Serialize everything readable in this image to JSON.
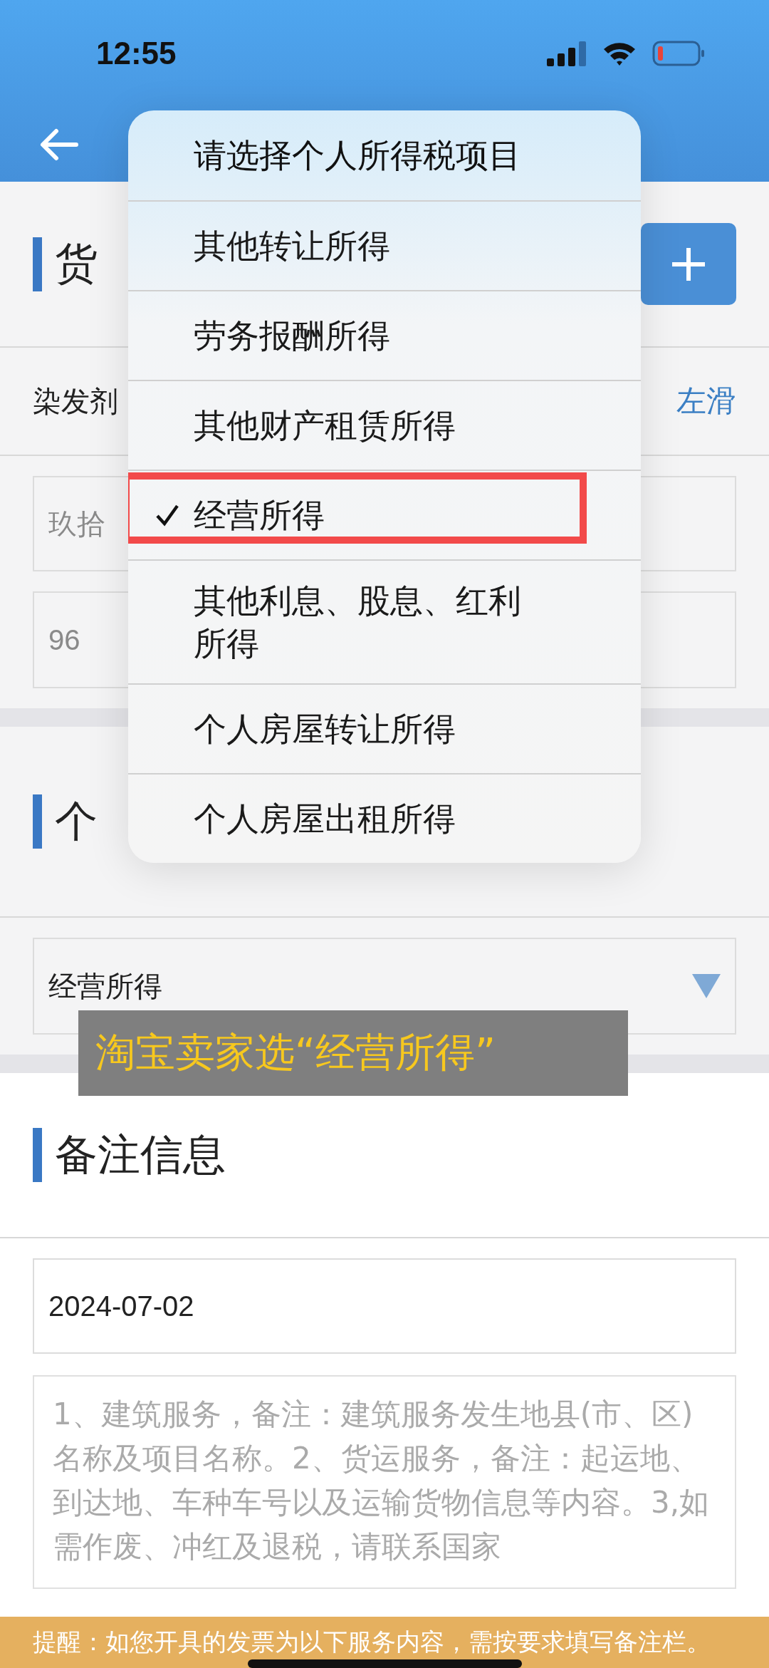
{
  "status_bar": {
    "time": "12:55"
  },
  "goods_section": {
    "title": "货",
    "item_name": "染发剂",
    "swipe_hint": "左滑",
    "amount_words": "玖拾",
    "amount": "96"
  },
  "income_section": {
    "title": "个",
    "select_value": "经营所得"
  },
  "remarks_section": {
    "title": "备注信息",
    "date": "2024-07-02",
    "placeholder": "1、建筑服务，备注：建筑服务发生地县(市、区)名称及项目名称。2、货运服务，备注：起运地、到达地、车种车号以及运输货物信息等内容。3,如需作废、冲红及退税，请联系国家"
  },
  "reminder": "提醒：如您开具的发票为以下服务内容，需按要求填写备注栏。",
  "caption": "淘宝卖家选“经营所得”",
  "dropdown": {
    "items": [
      {
        "kind": "prompt",
        "label": "请选择个人所得税项目",
        "selected": false
      },
      {
        "kind": "option",
        "label": "其他转让所得",
        "selected": false
      },
      {
        "kind": "option",
        "label": "劳务报酬所得",
        "selected": false
      },
      {
        "kind": "option",
        "label": "其他财产租赁所得",
        "selected": false
      },
      {
        "kind": "option",
        "label": "经营所得",
        "selected": true
      },
      {
        "kind": "option",
        "label": "其他利息、股息、红利所得",
        "selected": false
      },
      {
        "kind": "option",
        "label": "个人房屋转让所得",
        "selected": false
      },
      {
        "kind": "option",
        "label": "个人房屋出租所得",
        "selected": false
      }
    ]
  }
}
